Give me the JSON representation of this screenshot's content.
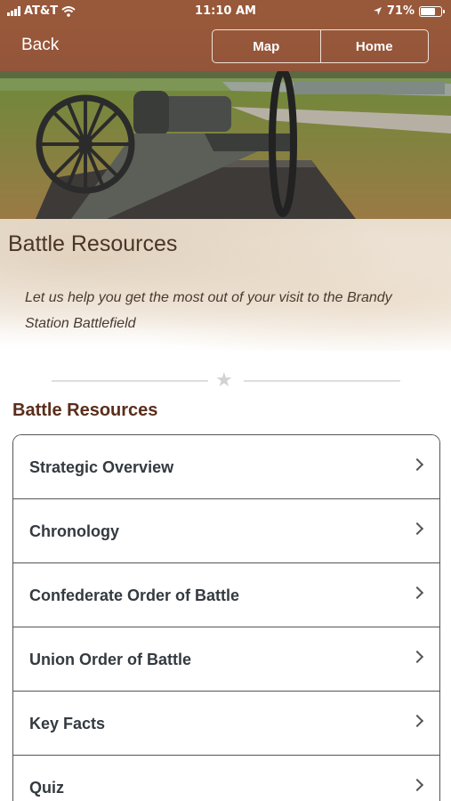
{
  "status_bar": {
    "carrier": "AT&T",
    "time": "11:10 AM",
    "battery": "71%",
    "battery_level": 0.71,
    "icons": [
      "signal-icon",
      "wifi-icon",
      "location-arrow-icon",
      "battery-icon"
    ]
  },
  "nav": {
    "back_label": "Back",
    "map_label": "Map",
    "home_label": "Home",
    "bar_color": "#98583a"
  },
  "intro": {
    "title": "Battle Resources",
    "text": "Let us help you get the most out of your visit to the Brandy Station Battlefield"
  },
  "section": {
    "title": "Battle Resources"
  },
  "resources": [
    {
      "label": "Strategic Overview"
    },
    {
      "label": "Chronology"
    },
    {
      "label": "Confederate Order of Battle"
    },
    {
      "label": "Union Order of Battle"
    },
    {
      "label": "Key Facts"
    },
    {
      "label": "Quiz"
    }
  ],
  "colors": {
    "brand_brown": "#98583a",
    "section_title": "#5a2e1c",
    "list_text": "#333a40"
  }
}
